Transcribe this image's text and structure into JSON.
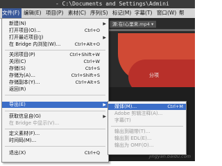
{
  "title_bar": {
    "text": "- C:\\Documents and Settings\\Admini"
  },
  "menubar": [
    {
      "label": "文件(F)"
    },
    {
      "label": "编辑(E)"
    },
    {
      "label": "项目(P)"
    },
    {
      "label": "素材(C)"
    },
    {
      "label": "序列(S)"
    },
    {
      "label": "标记(M)"
    },
    {
      "label": "字幕(T)"
    },
    {
      "label": "窗口(W)"
    },
    {
      "label": "帮"
    }
  ],
  "background": {
    "panel_tab": "源:在(心里来.mp4 ▾",
    "partial_text": "分项"
  },
  "file_menu": {
    "items": [
      {
        "label": "新建(N)",
        "shortcut": ""
      },
      {
        "label": "打开项目(O)...",
        "shortcut": "Ctrl+O"
      },
      {
        "label": "打开最近项目(J)",
        "shortcut": ""
      },
      {
        "label": "在 Bridge 内浏览(W)...",
        "shortcut": "Ctrl+Alt+O"
      },
      {
        "label": "关闭项目(P)",
        "shortcut": "Ctrl+Shift+W"
      },
      {
        "label": "关闭(C)",
        "shortcut": "Ctrl+W"
      },
      {
        "label": "存储(S)",
        "shortcut": "Ctrl+S"
      },
      {
        "label": "存储为(A)...",
        "shortcut": "Ctrl+Shift+S"
      },
      {
        "label": "存储副本(Y)...",
        "shortcut": "Ctrl+Alt+S"
      },
      {
        "label": "返回(R)",
        "shortcut": ""
      },
      {
        "label": "",
        "shortcut": ""
      },
      {
        "label": "导出(E)",
        "shortcut": ""
      },
      {
        "label": "获取信息自(G)",
        "shortcut": ""
      },
      {
        "label": "在 Bridge 中显示(V)...",
        "shortcut": ""
      },
      {
        "label": "定义素材(F)...",
        "shortcut": ""
      },
      {
        "label": "时间码(M)...",
        "shortcut": ""
      },
      {
        "label": "退出(X)",
        "shortcut": "Ctrl+Q"
      }
    ]
  },
  "export_submenu": {
    "items": [
      {
        "label": "媒体(M)...",
        "shortcut": "Ctrl+M"
      },
      {
        "label": "Adobe 剪辑注释(A)...",
        "shortcut": ""
      },
      {
        "label": "字幕(T)",
        "shortcut": ""
      },
      {
        "label": "输出到磁带(T)...",
        "shortcut": ""
      },
      {
        "label": "输出到 EDL(E)...",
        "shortcut": ""
      },
      {
        "label": "输出为 OMF(O)...",
        "shortcut": ""
      }
    ]
  },
  "watermark": "jingyan.baidu.com"
}
